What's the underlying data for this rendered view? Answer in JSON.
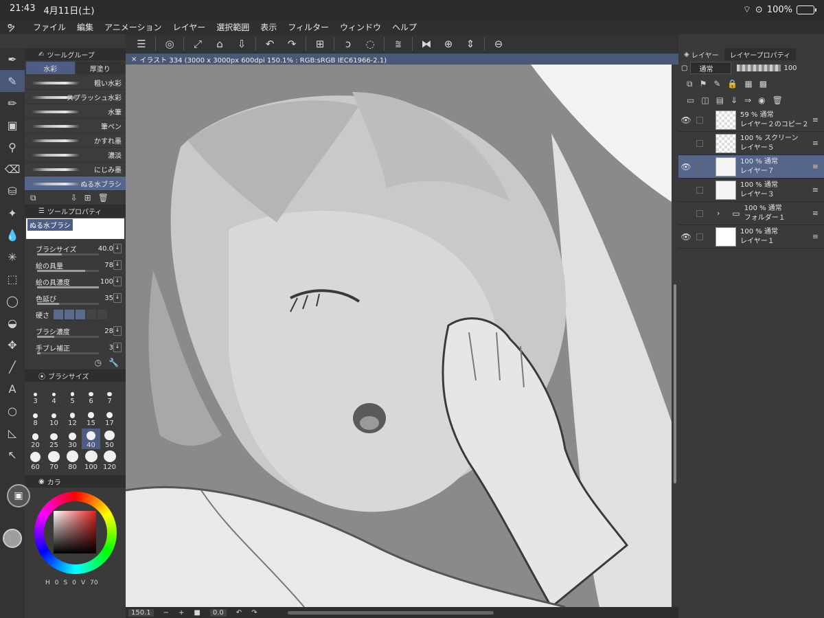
{
  "status": {
    "time": "21:43",
    "date": "4月11日(土)",
    "battery": "100%"
  },
  "menu": [
    "ファイル",
    "編集",
    "アニメーション",
    "レイヤー",
    "選択範囲",
    "表示",
    "フィルター",
    "ウィンドウ",
    "ヘルプ"
  ],
  "tool_group": {
    "title": "ツールグループ",
    "tabs": [
      "水彩",
      "厚塗り"
    ]
  },
  "brushes": [
    "粗い水彩",
    "スプラッシュ水彩",
    "水筆",
    "筆ペン",
    "かすれ墨",
    "濃淡",
    "にじみ墨",
    "ぬる水ブラシ"
  ],
  "tool_property": {
    "title": "ツールプロパティ",
    "brush_name": "ぬる水ブラシ",
    "props": [
      {
        "label": "ブラシサイズ",
        "value": "40.0",
        "fill": 0.4
      },
      {
        "label": "絵の具量",
        "value": "78",
        "fill": 0.78
      },
      {
        "label": "絵の具濃度",
        "value": "100",
        "fill": 1.0
      },
      {
        "label": "色延び",
        "value": "35",
        "fill": 0.35
      }
    ],
    "hardness_label": "硬さ",
    "props2": [
      {
        "label": "ブラシ濃度",
        "value": "28",
        "fill": 0.28
      },
      {
        "label": "手ブレ補正",
        "value": "3",
        "fill": 0.06
      }
    ]
  },
  "brush_size": {
    "title": "ブラシサイズ",
    "sizes": [
      "3",
      "4",
      "5",
      "6",
      "7",
      "8",
      "10",
      "12",
      "15",
      "17",
      "20",
      "25",
      "30",
      "40",
      "50",
      "60",
      "70",
      "80",
      "100",
      "120"
    ],
    "selected": "40"
  },
  "color": {
    "title": "カラ",
    "readout": [
      "H",
      "0",
      "S",
      "0",
      "V",
      "70"
    ]
  },
  "document": {
    "tab": "イラスト 334 (3000 x 3000px 600dpi 150.1% : RGB:sRGB IEC61966-2.1)",
    "zoom": "150.1",
    "angle": "0.0"
  },
  "layer_panel": {
    "tabs": [
      "レイヤー",
      "レイヤープロパティ"
    ],
    "blend_mode": "通常",
    "opacity": "100",
    "layers": [
      {
        "opacity_mode": "59 % 通常",
        "name": "レイヤー２のコピー２",
        "visible": true,
        "active": false,
        "kind": "trans"
      },
      {
        "opacity_mode": "100 % スクリーン",
        "name": "レイヤー５",
        "visible": false,
        "active": false,
        "kind": "trans"
      },
      {
        "opacity_mode": "100 % 通常",
        "name": "レイヤー７",
        "visible": true,
        "active": true,
        "kind": "sketch"
      },
      {
        "opacity_mode": "100 % 通常",
        "name": "レイヤー３",
        "visible": false,
        "active": false,
        "kind": "sketch"
      },
      {
        "opacity_mode": "100 % 通常",
        "name": "フォルダー１",
        "visible": false,
        "active": false,
        "kind": "folder"
      },
      {
        "opacity_mode": "100 % 通常",
        "name": "レイヤー１",
        "visible": true,
        "active": false,
        "kind": "white"
      }
    ]
  }
}
